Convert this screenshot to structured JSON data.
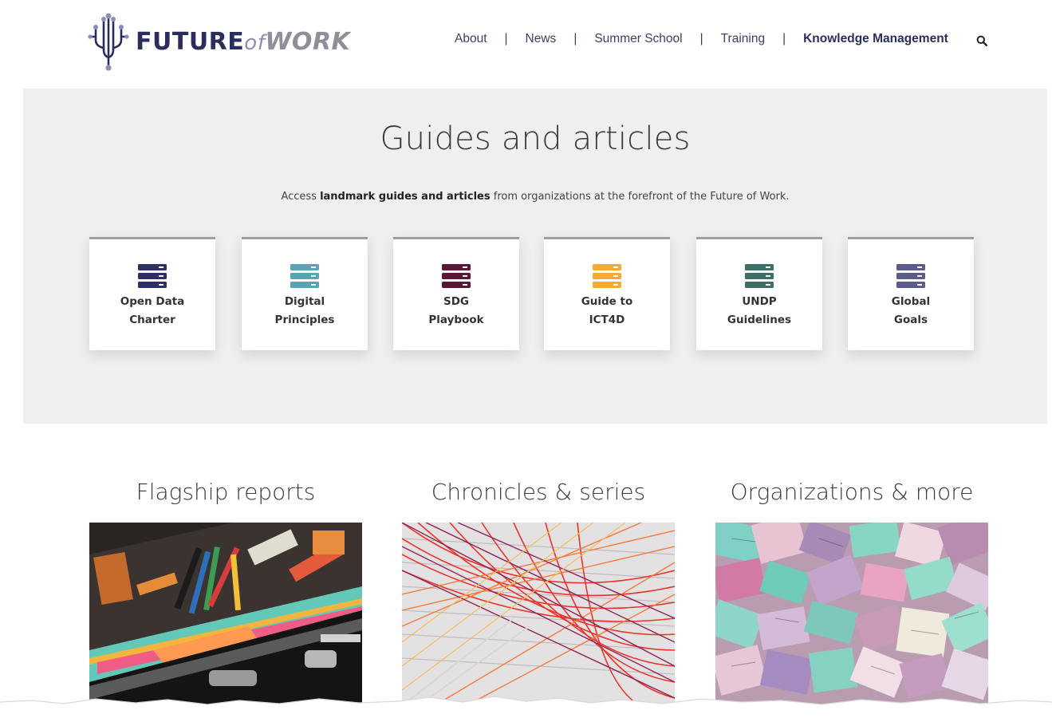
{
  "header": {
    "logo": {
      "part1": "FUTURE",
      "part2": "of",
      "part3": "WORK"
    },
    "nav": [
      {
        "label": "About",
        "active": false
      },
      {
        "label": "News",
        "active": false
      },
      {
        "label": "Summer School",
        "active": false
      },
      {
        "label": "Training",
        "active": false
      },
      {
        "label": "Knowledge Management",
        "active": true
      }
    ],
    "separator": "|",
    "search_icon": "search-icon"
  },
  "guides": {
    "title": "Guides and articles",
    "subtitle_pre": "Access ",
    "subtitle_bold": "landmark guides and articles",
    "subtitle_post": " from organizations at the forefront of the Future of Work.",
    "cards": [
      {
        "line1": "Open Data",
        "line2": "Charter",
        "icon": "database-icon",
        "color": "#2e2f63"
      },
      {
        "line1": "Digital",
        "line2": "Principles",
        "icon": "database-icon",
        "color": "#5aa3b5"
      },
      {
        "line1": "SDG",
        "line2": "Playbook",
        "icon": "database-icon",
        "color": "#5a1838"
      },
      {
        "line1": "Guide to",
        "line2": "ICT4D",
        "icon": "database-icon",
        "color": "#f5ab32"
      },
      {
        "line1": "UNDP",
        "line2": "Guidelines",
        "icon": "database-icon",
        "color": "#3f6e66"
      },
      {
        "line1": "Global",
        "line2": "Goals",
        "icon": "database-icon",
        "color": "#5c5b8e"
      }
    ]
  },
  "sections": [
    {
      "title": "Flagship reports",
      "image": "toolbox-photo"
    },
    {
      "title": "Chronicles & series",
      "image": "threads-photo"
    },
    {
      "title": "Organizations & more",
      "image": "paper-scraps-photo"
    }
  ],
  "colors": {
    "brand_dark": "#2b2d5c",
    "panel_bg": "#efefef",
    "card_border": "#9e9e9e"
  }
}
